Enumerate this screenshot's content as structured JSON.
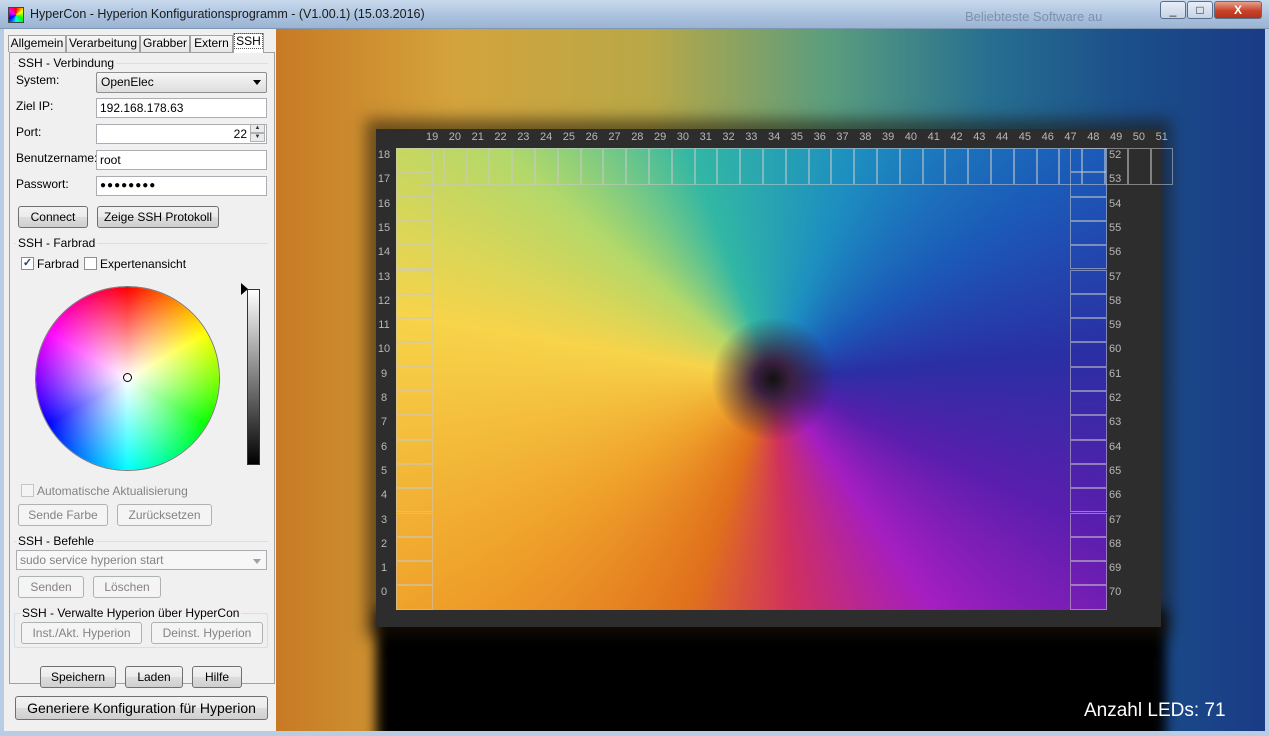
{
  "window": {
    "title": "HyperCon - Hyperion Konfigurationsprogramm - (V1.00.1) (15.03.2016)",
    "background_text": "Beliebteste Software au",
    "minimize": "_",
    "maximize": "□",
    "close": "X"
  },
  "tabs": [
    "Allgemein",
    "Verarbeitung",
    "Grabber",
    "Extern",
    "SSH"
  ],
  "ssh_connection": {
    "group": "SSH - Verbindung",
    "system_label": "System:",
    "system_value": "OpenElec",
    "ip_label": "Ziel IP:",
    "ip_value": "192.168.178.63",
    "port_label": "Port:",
    "port_value": "22",
    "user_label": "Benutzername:",
    "user_value": "root",
    "password_label": "Passwort:",
    "password_value": "●●●●●●●●",
    "connect": "Connect",
    "show_log": "Zeige SSH Protokoll"
  },
  "ssh_colorwheel": {
    "group": "SSH - Farbrad",
    "colorwheel_check": "Farbrad",
    "colorwheel_checked": true,
    "expert_check": "Expertenansicht",
    "expert_checked": false,
    "auto_update": "Automatische Aktualisierung",
    "send_color": "Sende Farbe",
    "reset": "Zurücksetzen",
    "checkmark": "✓"
  },
  "ssh_commands": {
    "group": "SSH - Befehle",
    "command_value": "sudo service hyperion start",
    "send": "Senden",
    "delete": "Löschen"
  },
  "ssh_manage": {
    "group": "SSH - Verwalte Hyperion über HyperCon",
    "install": "Inst./Akt. Hyperion",
    "uninstall": "Deinst. Hyperion"
  },
  "footer": {
    "save": "Speichern",
    "load": "Laden",
    "help": "Hilfe",
    "generate": "Generiere Konfiguration für Hyperion"
  },
  "preview": {
    "led_count_text": "Anzahl LEDs: 71",
    "top_numbers": [
      "19",
      "20",
      "21",
      "22",
      "23",
      "24",
      "25",
      "26",
      "27",
      "28",
      "29",
      "30",
      "31",
      "32",
      "33",
      "34",
      "35",
      "36",
      "37",
      "38",
      "39",
      "40",
      "41",
      "42",
      "43",
      "44",
      "45",
      "46",
      "47",
      "48",
      "49",
      "50",
      "51"
    ],
    "left_numbers": [
      "18",
      "17",
      "16",
      "15",
      "14",
      "13",
      "12",
      "11",
      "10",
      "9",
      "8",
      "7",
      "6",
      "5",
      "4",
      "3",
      "2",
      "1",
      "0"
    ],
    "right_numbers": [
      "52",
      "53",
      "54",
      "55",
      "56",
      "57",
      "58",
      "59",
      "60",
      "61",
      "62",
      "63",
      "64",
      "65",
      "66",
      "67",
      "68",
      "69",
      "70"
    ]
  }
}
